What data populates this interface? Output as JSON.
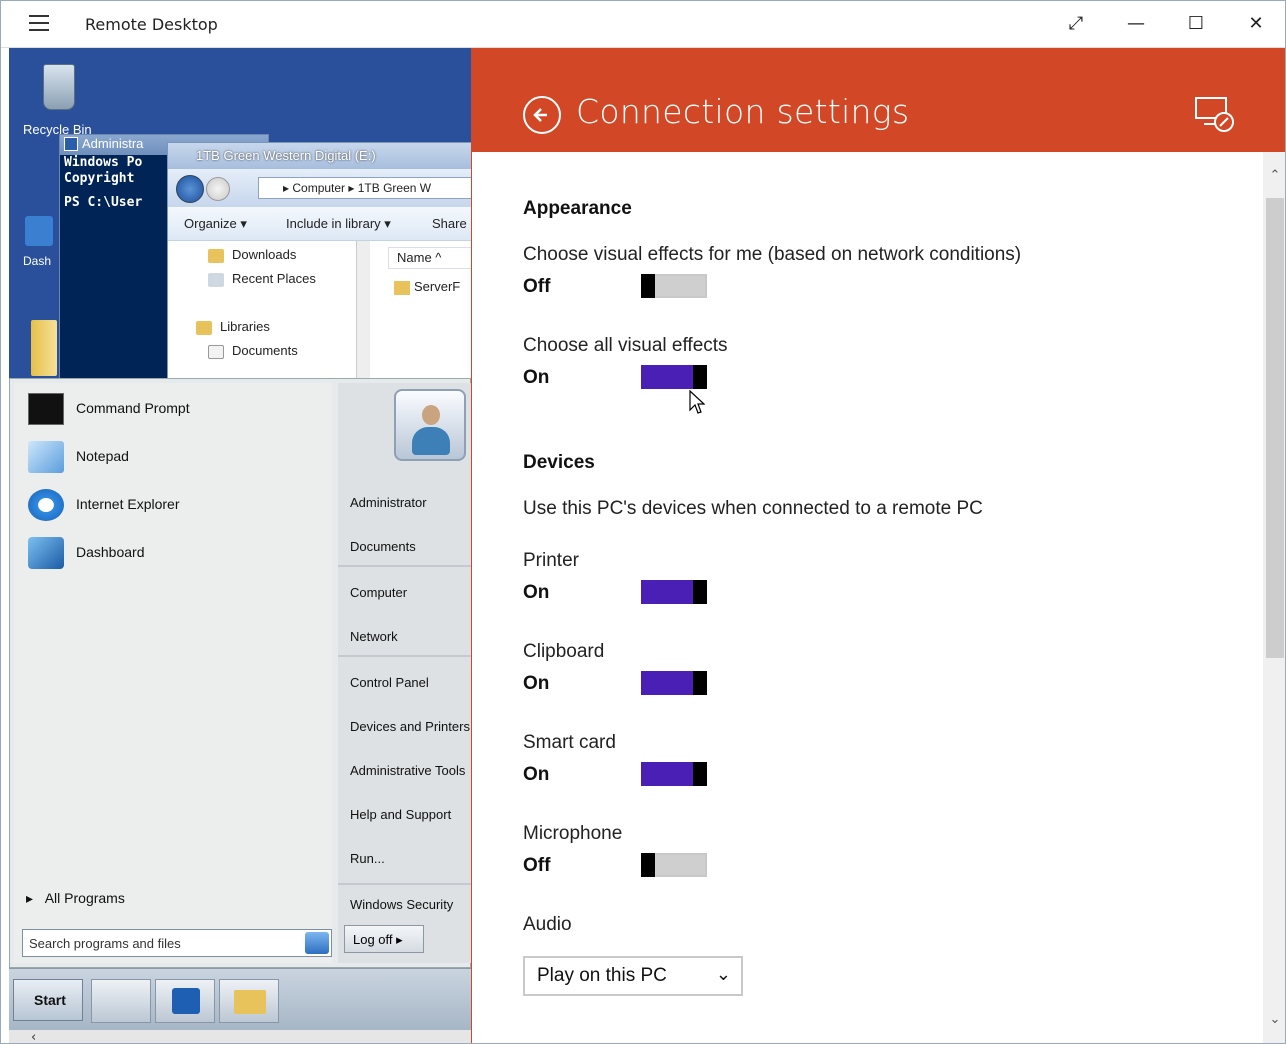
{
  "window": {
    "title": "Remote Desktop",
    "controls": {
      "fullscreen": "⤢",
      "minimize": "—",
      "maximize": "☐",
      "close": "✕"
    }
  },
  "remote_desktop": {
    "desktop_icons": {
      "recycle_bin": "Recycle Bin",
      "dashboard": "Dash"
    },
    "powershell": {
      "title": "Administra",
      "lines": [
        "Windows Po",
        "Copyright",
        "",
        "PS C:\\User"
      ]
    },
    "explorer": {
      "title": "1TB Green Western Digital (E:)",
      "address": "▸ Computer ▸ 1TB Green W",
      "toolbar": {
        "organize": "Organize ▾",
        "include": "Include in library ▾",
        "share": "Share"
      },
      "nav": [
        "Downloads",
        "Recent Places",
        "Libraries",
        "Documents"
      ],
      "column": "Name ^",
      "item": "ServerF"
    },
    "start_menu": {
      "left_items": [
        "Command Prompt",
        "Notepad",
        "Internet Explorer",
        "Dashboard"
      ],
      "right_items": [
        "Administrator",
        "Documents",
        "Computer",
        "Network",
        "Control Panel",
        "Devices and Printers",
        "Administrative Tools",
        "Help and Support",
        "Run...",
        "Windows Security"
      ],
      "all_programs": "All Programs",
      "search_placeholder": "Search programs and files",
      "log_off": "Log off"
    },
    "taskbar": {
      "start": "Start"
    }
  },
  "settings": {
    "title": "Connection settings",
    "sections": {
      "appearance": "Appearance",
      "devices": "Devices"
    },
    "appearance": {
      "auto_label": "Choose visual effects for me (based on network conditions)",
      "auto_state": "Off",
      "all_label": "Choose all visual effects",
      "all_state": "On"
    },
    "devices": {
      "description": "Use this PC's devices when connected to a remote PC",
      "printer_label": "Printer",
      "printer_state": "On",
      "clipboard_label": "Clipboard",
      "clipboard_state": "On",
      "smartcard_label": "Smart card",
      "smartcard_state": "On",
      "microphone_label": "Microphone",
      "microphone_state": "Off"
    },
    "audio": {
      "label": "Audio",
      "selected": "Play on this PC"
    },
    "colors": {
      "header": "#d24726",
      "toggle_on": "#4a1fb6",
      "toggle_off": "#cfcfcf"
    }
  }
}
